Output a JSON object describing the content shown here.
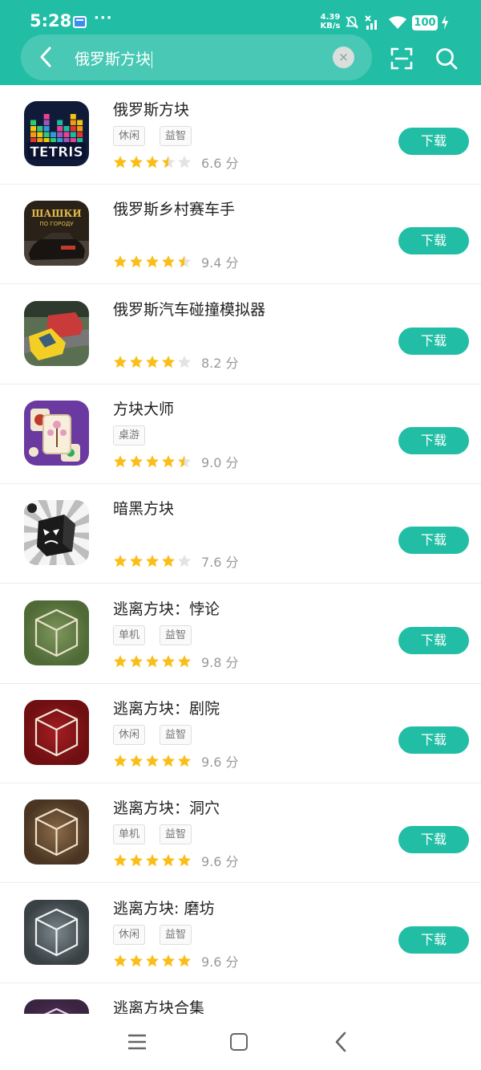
{
  "status": {
    "time": "5:28",
    "dots": "···",
    "speed_value": "4.39",
    "speed_unit": "KB/s",
    "battery": "100"
  },
  "search": {
    "query": "俄罗斯方块",
    "clear_label": "×"
  },
  "download_label": "下载",
  "score_unit": "分",
  "apps": [
    {
      "title": "俄罗斯方块",
      "tags": [
        "休闲",
        "益智"
      ],
      "stars": 3.5,
      "score": "6.6",
      "icon": "tetris-icon"
    },
    {
      "title": "俄罗斯乡村赛车手",
      "tags": [],
      "stars": 4.5,
      "score": "9.4",
      "icon": "racing-car-icon",
      "icon_text_1": "ШАШКИ",
      "icon_text_2": "ПО ГОРОДУ"
    },
    {
      "title": "俄罗斯汽车碰撞模拟器",
      "tags": [],
      "stars": 4,
      "score": "8.2",
      "icon": "car-crash-icon"
    },
    {
      "title": "方块大师",
      "tags": [
        "桌游"
      ],
      "stars": 4.5,
      "score": "9.0",
      "icon": "mahjong-tile-icon"
    },
    {
      "title": "暗黑方块",
      "tags": [],
      "stars": 4,
      "score": "7.6",
      "icon": "dark-cube-icon"
    },
    {
      "title": "逃离方块：悖论",
      "tags": [
        "单机",
        "益智"
      ],
      "stars": 5,
      "score": "9.8",
      "icon": "cube-green-icon"
    },
    {
      "title": "逃离方块：剧院",
      "tags": [
        "休闲",
        "益智"
      ],
      "stars": 5,
      "score": "9.6",
      "icon": "cube-red-icon"
    },
    {
      "title": "逃离方块：洞穴",
      "tags": [
        "单机",
        "益智"
      ],
      "stars": 5,
      "score": "9.6",
      "icon": "cube-brown-icon"
    },
    {
      "title": "逃离方块: 磨坊",
      "tags": [
        "休闲",
        "益智"
      ],
      "stars": 5,
      "score": "9.6",
      "icon": "cube-grey-icon"
    },
    {
      "title": "逃离方块合集",
      "tags": [],
      "stars": 0,
      "score": "",
      "icon": "cube-collection-icon"
    }
  ],
  "colors": {
    "accent": "#21bea5",
    "star": "#fbbd18",
    "star_empty": "#e3e3e3"
  }
}
